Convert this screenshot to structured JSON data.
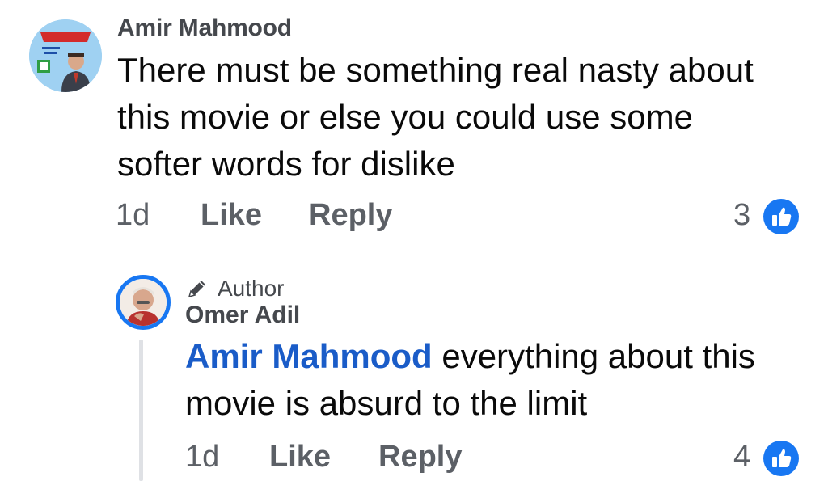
{
  "comment": {
    "author": "Amir Mahmood",
    "text": "There must be something real nasty about this movie or else you could use some softer words for dislike",
    "time": "1d",
    "like_label": "Like",
    "reply_label": "Reply",
    "reaction_count": "3",
    "reaction_icon": "thumbs-up-icon"
  },
  "reply": {
    "badge_icon": "pencil-icon",
    "badge_label": "Author",
    "author": "Omer Adil",
    "mention": "Amir Mahmood",
    "text": " everything about this movie is absurd to the limit",
    "time": "1d",
    "like_label": "Like",
    "reply_label": "Reply",
    "reaction_count": "4",
    "reaction_icon": "thumbs-up-icon"
  },
  "colors": {
    "accent": "#1877f2",
    "mention": "#1a5cc8",
    "meta_text": "#5c6066"
  }
}
